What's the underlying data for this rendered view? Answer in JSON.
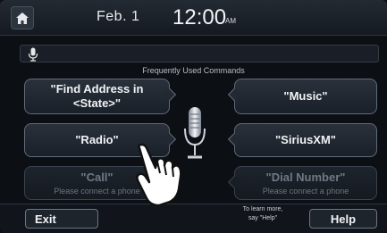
{
  "status_bar": {
    "home_icon": "home-icon",
    "date": "Feb.  1",
    "time": "12:00",
    "ampm": "AM"
  },
  "voice_bar": {
    "mic_icon": "microphone-icon"
  },
  "title": "Frequently Used Commands",
  "commands": [
    {
      "label": "\"Find Address in <State>\"",
      "sub": "",
      "enabled": true
    },
    {
      "label": "\"Music\"",
      "sub": "",
      "enabled": true
    },
    {
      "label": "\"Radio\"",
      "sub": "",
      "enabled": true
    },
    {
      "label": "\"SiriusXM\"",
      "sub": "",
      "enabled": true
    },
    {
      "label": "\"Call\"",
      "sub": "Please connect a phone",
      "enabled": false
    },
    {
      "label": "\"Dial Number\"",
      "sub": "Please connect a phone",
      "enabled": false
    }
  ],
  "center_icon": "microphone-icon",
  "bottom": {
    "exit_label": "Exit",
    "hint_line1": "To learn more,",
    "hint_line2": "say \"Help\"",
    "help_label": "Help"
  },
  "overlay": {
    "icon": "pointing-hand-icon"
  },
  "colors": {
    "background": "#0c0f14",
    "text": "#f1f3f5",
    "disabled_text": "#6f7884",
    "border": "#5f6b79"
  }
}
